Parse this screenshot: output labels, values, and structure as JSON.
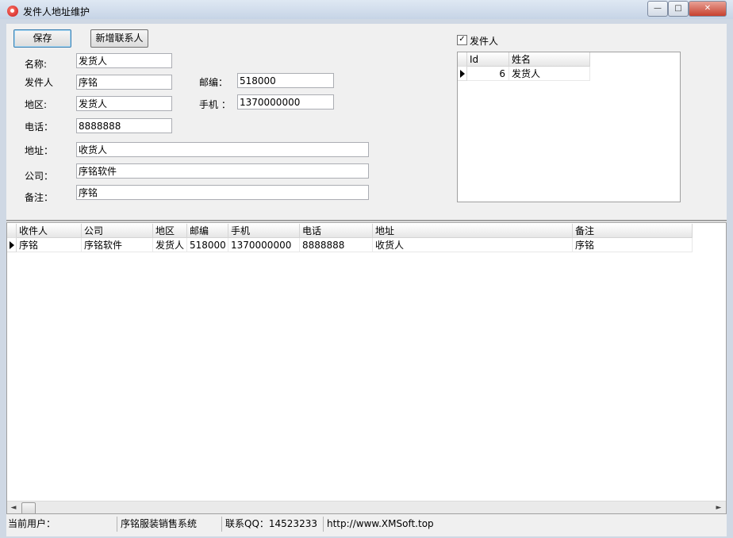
{
  "window": {
    "title": "发件人地址维护",
    "min_glyph": "—",
    "max_glyph": "□",
    "close_glyph": "✕"
  },
  "toolbar": {
    "save_label": "保存",
    "add_contact_label": "新增联系人"
  },
  "form": {
    "name_label": "名称:",
    "name_value": "发货人",
    "sender_label": "发件人",
    "sender_value": "序铭",
    "postcode_label": "邮编：",
    "postcode_value": "518000",
    "region_label": "地区:",
    "region_value": "发货人",
    "mobile_label": "手机 ：",
    "mobile_value": "1370000000",
    "phone_label": "电话：",
    "phone_value": "8888888",
    "address_label": "地址：",
    "address_value": "收货人",
    "company_label": "公司：",
    "company_value": "序铭软件",
    "notes_label": "备注：",
    "notes_value": "序铭"
  },
  "sender_filter": {
    "label": "发件人",
    "checked": true,
    "check_glyph": "✓"
  },
  "sender_grid": {
    "columns": [
      "Id",
      "姓名"
    ],
    "rows": [
      [
        "6",
        "发货人"
      ]
    ]
  },
  "address_grid": {
    "columns": [
      "收件人",
      "公司",
      "地区",
      "邮编",
      "手机",
      "电话",
      "地址",
      "备注"
    ],
    "rows": [
      [
        "序铭",
        "序铭软件",
        "发货人",
        "518000",
        "1370000000",
        "8888888",
        "收货人",
        "序铭"
      ]
    ]
  },
  "scrollbar": {
    "left_glyph": "◄",
    "right_glyph": "►"
  },
  "statusbar": {
    "current_user_label": "当前用户：",
    "system_name": "序铭服装销售系统",
    "contact_qq": "联系QQ：14523233",
    "website": "http://www.XMSoft.top"
  }
}
